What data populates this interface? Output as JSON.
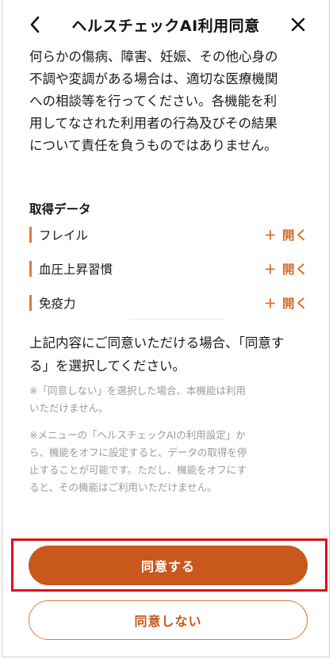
{
  "header": {
    "title": "ヘルスチェックAI利用同意",
    "back_icon": "chevron-left-icon",
    "close_icon": "close-icon"
  },
  "disclaimer": {
    "line1": "何らかの傷病、障害、妊娠、その他心身の",
    "line2": "不調や変調がある場合は、適切な医療機関",
    "line3": "への相談等を行ってください。各機能を利",
    "line4": "用してなされた利用者の行為及びその結果",
    "line5": "について責任を負うものではありません。"
  },
  "acquired_data": {
    "heading": "取得データ",
    "items": [
      {
        "label": "フレイル",
        "action": "＋ 開く"
      },
      {
        "label": "血圧上昇習慣",
        "action": "＋ 開く"
      },
      {
        "label": "免疫力",
        "action": "＋ 開く"
      }
    ]
  },
  "consent": {
    "line1": "上記内容にご同意いただける場合、「同意す",
    "line2": "る」を選択してください。",
    "note1_line1": "※「同意しない」を選択した場合、本機能は利用",
    "note1_line2": "いただけません。",
    "note2_line1": "※メニューの「ヘルスチェックAIの利用設定」か",
    "note2_line2": "ら、機能をオフに設定すると、データの取得を停",
    "note2_line3": "止することが可能です。ただし、機能をオフにす",
    "note2_line4": "ると、その機能はご利用いただけません。"
  },
  "buttons": {
    "agree": "同意する",
    "disagree": "同意しない"
  },
  "colors": {
    "accent": "#c8581b",
    "accent_light": "#e0793a",
    "highlight": "#e0101a"
  }
}
